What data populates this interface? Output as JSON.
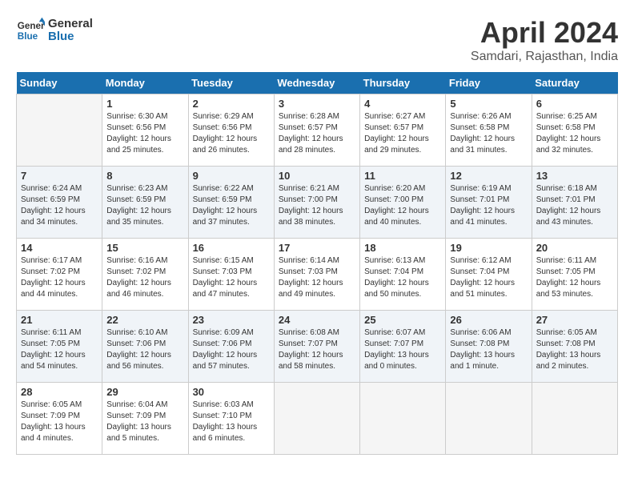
{
  "header": {
    "logo_line1": "General",
    "logo_line2": "Blue",
    "month_title": "April 2024",
    "subtitle": "Samdari, Rajasthan, India"
  },
  "days_of_week": [
    "Sunday",
    "Monday",
    "Tuesday",
    "Wednesday",
    "Thursday",
    "Friday",
    "Saturday"
  ],
  "weeks": [
    [
      {
        "day": "",
        "info": ""
      },
      {
        "day": "1",
        "info": "Sunrise: 6:30 AM\nSunset: 6:56 PM\nDaylight: 12 hours\nand 25 minutes."
      },
      {
        "day": "2",
        "info": "Sunrise: 6:29 AM\nSunset: 6:56 PM\nDaylight: 12 hours\nand 26 minutes."
      },
      {
        "day": "3",
        "info": "Sunrise: 6:28 AM\nSunset: 6:57 PM\nDaylight: 12 hours\nand 28 minutes."
      },
      {
        "day": "4",
        "info": "Sunrise: 6:27 AM\nSunset: 6:57 PM\nDaylight: 12 hours\nand 29 minutes."
      },
      {
        "day": "5",
        "info": "Sunrise: 6:26 AM\nSunset: 6:58 PM\nDaylight: 12 hours\nand 31 minutes."
      },
      {
        "day": "6",
        "info": "Sunrise: 6:25 AM\nSunset: 6:58 PM\nDaylight: 12 hours\nand 32 minutes."
      }
    ],
    [
      {
        "day": "7",
        "info": "Sunrise: 6:24 AM\nSunset: 6:59 PM\nDaylight: 12 hours\nand 34 minutes."
      },
      {
        "day": "8",
        "info": "Sunrise: 6:23 AM\nSunset: 6:59 PM\nDaylight: 12 hours\nand 35 minutes."
      },
      {
        "day": "9",
        "info": "Sunrise: 6:22 AM\nSunset: 6:59 PM\nDaylight: 12 hours\nand 37 minutes."
      },
      {
        "day": "10",
        "info": "Sunrise: 6:21 AM\nSunset: 7:00 PM\nDaylight: 12 hours\nand 38 minutes."
      },
      {
        "day": "11",
        "info": "Sunrise: 6:20 AM\nSunset: 7:00 PM\nDaylight: 12 hours\nand 40 minutes."
      },
      {
        "day": "12",
        "info": "Sunrise: 6:19 AM\nSunset: 7:01 PM\nDaylight: 12 hours\nand 41 minutes."
      },
      {
        "day": "13",
        "info": "Sunrise: 6:18 AM\nSunset: 7:01 PM\nDaylight: 12 hours\nand 43 minutes."
      }
    ],
    [
      {
        "day": "14",
        "info": "Sunrise: 6:17 AM\nSunset: 7:02 PM\nDaylight: 12 hours\nand 44 minutes."
      },
      {
        "day": "15",
        "info": "Sunrise: 6:16 AM\nSunset: 7:02 PM\nDaylight: 12 hours\nand 46 minutes."
      },
      {
        "day": "16",
        "info": "Sunrise: 6:15 AM\nSunset: 7:03 PM\nDaylight: 12 hours\nand 47 minutes."
      },
      {
        "day": "17",
        "info": "Sunrise: 6:14 AM\nSunset: 7:03 PM\nDaylight: 12 hours\nand 49 minutes."
      },
      {
        "day": "18",
        "info": "Sunrise: 6:13 AM\nSunset: 7:04 PM\nDaylight: 12 hours\nand 50 minutes."
      },
      {
        "day": "19",
        "info": "Sunrise: 6:12 AM\nSunset: 7:04 PM\nDaylight: 12 hours\nand 51 minutes."
      },
      {
        "day": "20",
        "info": "Sunrise: 6:11 AM\nSunset: 7:05 PM\nDaylight: 12 hours\nand 53 minutes."
      }
    ],
    [
      {
        "day": "21",
        "info": "Sunrise: 6:11 AM\nSunset: 7:05 PM\nDaylight: 12 hours\nand 54 minutes."
      },
      {
        "day": "22",
        "info": "Sunrise: 6:10 AM\nSunset: 7:06 PM\nDaylight: 12 hours\nand 56 minutes."
      },
      {
        "day": "23",
        "info": "Sunrise: 6:09 AM\nSunset: 7:06 PM\nDaylight: 12 hours\nand 57 minutes."
      },
      {
        "day": "24",
        "info": "Sunrise: 6:08 AM\nSunset: 7:07 PM\nDaylight: 12 hours\nand 58 minutes."
      },
      {
        "day": "25",
        "info": "Sunrise: 6:07 AM\nSunset: 7:07 PM\nDaylight: 13 hours\nand 0 minutes."
      },
      {
        "day": "26",
        "info": "Sunrise: 6:06 AM\nSunset: 7:08 PM\nDaylight: 13 hours\nand 1 minute."
      },
      {
        "day": "27",
        "info": "Sunrise: 6:05 AM\nSunset: 7:08 PM\nDaylight: 13 hours\nand 2 minutes."
      }
    ],
    [
      {
        "day": "28",
        "info": "Sunrise: 6:05 AM\nSunset: 7:09 PM\nDaylight: 13 hours\nand 4 minutes."
      },
      {
        "day": "29",
        "info": "Sunrise: 6:04 AM\nSunset: 7:09 PM\nDaylight: 13 hours\nand 5 minutes."
      },
      {
        "day": "30",
        "info": "Sunrise: 6:03 AM\nSunset: 7:10 PM\nDaylight: 13 hours\nand 6 minutes."
      },
      {
        "day": "",
        "info": ""
      },
      {
        "day": "",
        "info": ""
      },
      {
        "day": "",
        "info": ""
      },
      {
        "day": "",
        "info": ""
      }
    ]
  ]
}
